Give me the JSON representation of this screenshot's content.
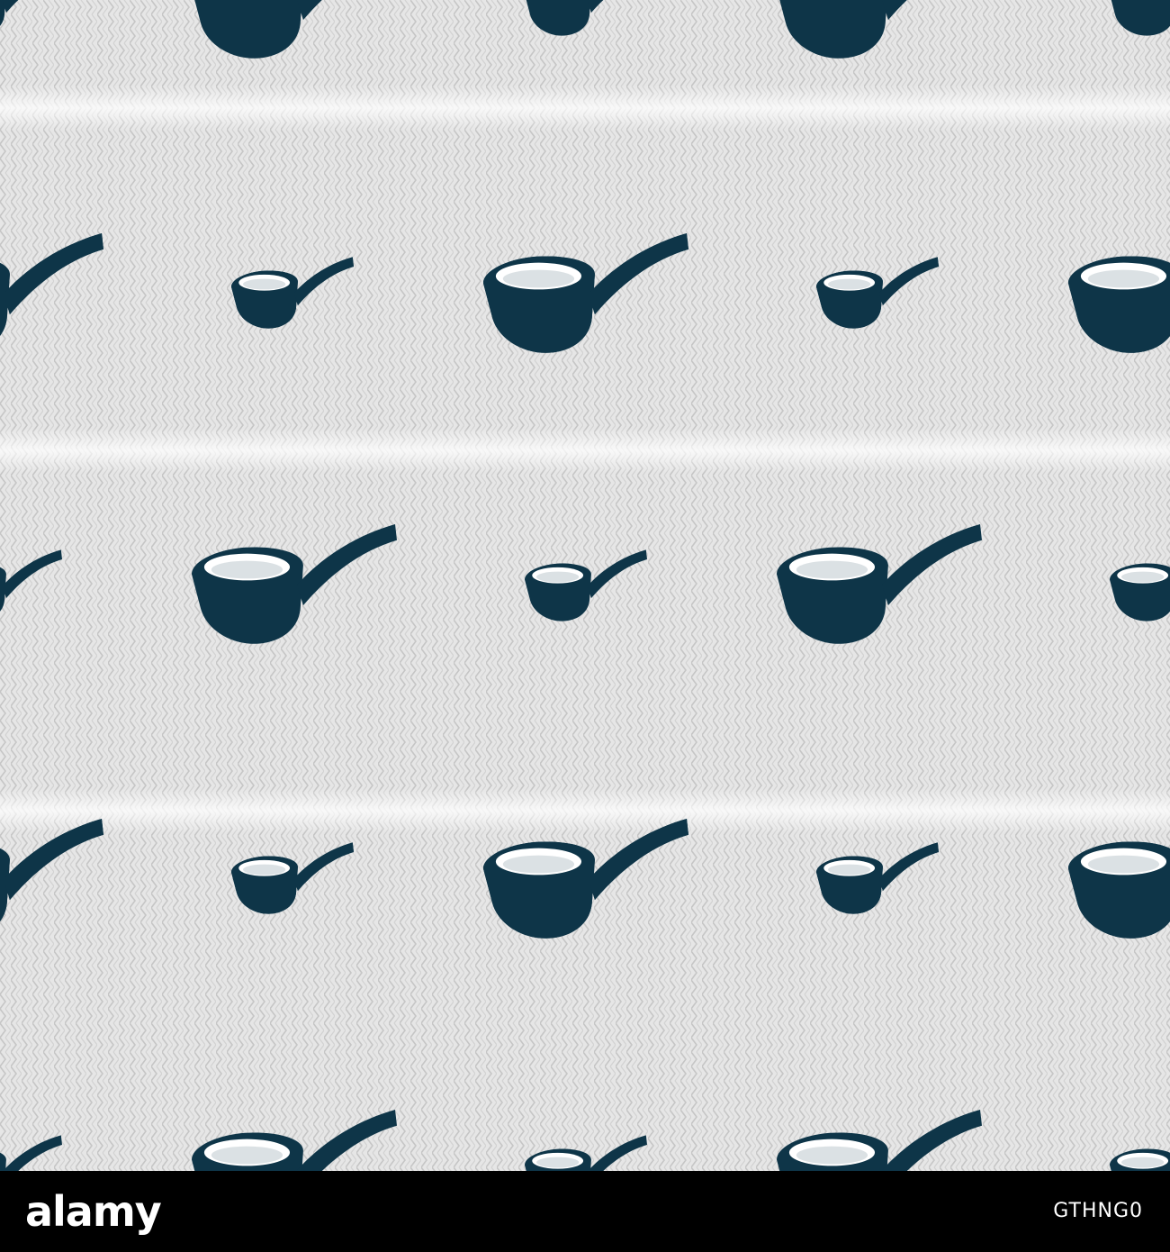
{
  "pattern": {
    "icon": "tobacco-pipe-icon",
    "icon_color": "#0e3548",
    "background_color": "#e6e6e6",
    "line_color": "#c6c6c6"
  },
  "footer": {
    "logo_text": "alamy",
    "image_id": "GTHNG0",
    "background_color": "#000000",
    "text_color": "#ffffff"
  }
}
